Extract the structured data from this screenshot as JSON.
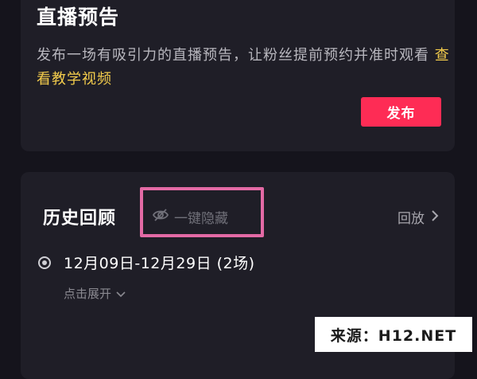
{
  "preview": {
    "title": "直播预告",
    "description": "发布一场有吸引力的直播预告，让粉丝提前预约并准时观看",
    "tutorial_link": "查看教学视频",
    "publish_label": "发布"
  },
  "history": {
    "title": "历史回顾",
    "hide_all_label": "一键隐藏",
    "replay_label": "回放",
    "period_label": "12月09日-12月29日 (2场)",
    "expand_label": "点击展开"
  },
  "watermark": "来源：H12.NET",
  "colors": {
    "background": "#15141c",
    "card": "#1f1e27",
    "accent": "#fe2c55",
    "link": "#f3cc4c",
    "highlight": "#e36aa5"
  },
  "icons": [
    "eye-slash-icon",
    "chevron-right-icon",
    "chevron-down-icon",
    "radio-selected-icon"
  ]
}
